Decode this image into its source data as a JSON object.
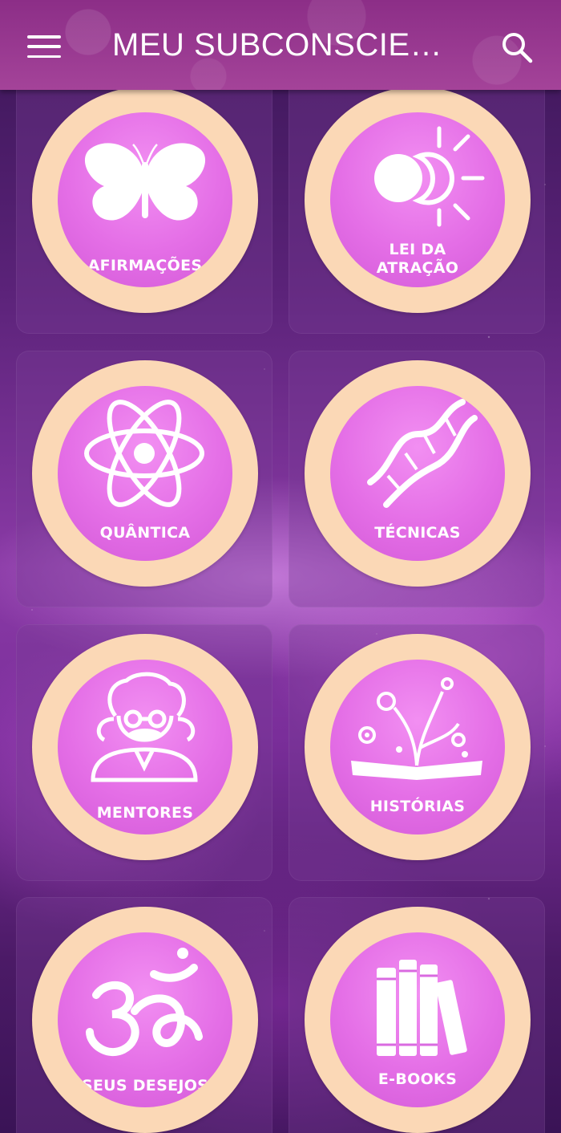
{
  "header": {
    "title": "MEU SUBCONSCIE…",
    "menu_icon": "hamburger-menu-icon",
    "search_icon": "search-icon"
  },
  "menu": [
    {
      "label": "AFIRMAÇÕES",
      "icon": "butterfly-icon"
    },
    {
      "label": "LEI DA ATRAÇÃO",
      "icon": "sun-moon-icon"
    },
    {
      "label": "QUÂNTICA",
      "icon": "atom-icon"
    },
    {
      "label": "TÉCNICAS",
      "icon": "dna-icon"
    },
    {
      "label": "MENTORES",
      "icon": "mentor-face-icon"
    },
    {
      "label": "HISTÓRIAS",
      "icon": "open-book-tree-icon"
    },
    {
      "label": "SEUS DESEJOS",
      "icon": "om-icon"
    },
    {
      "label": "E-BOOKS",
      "icon": "books-icon"
    }
  ],
  "colors": {
    "header": "#a44399",
    "ring": "#fbd8b6",
    "circle": "#e46ee6"
  }
}
